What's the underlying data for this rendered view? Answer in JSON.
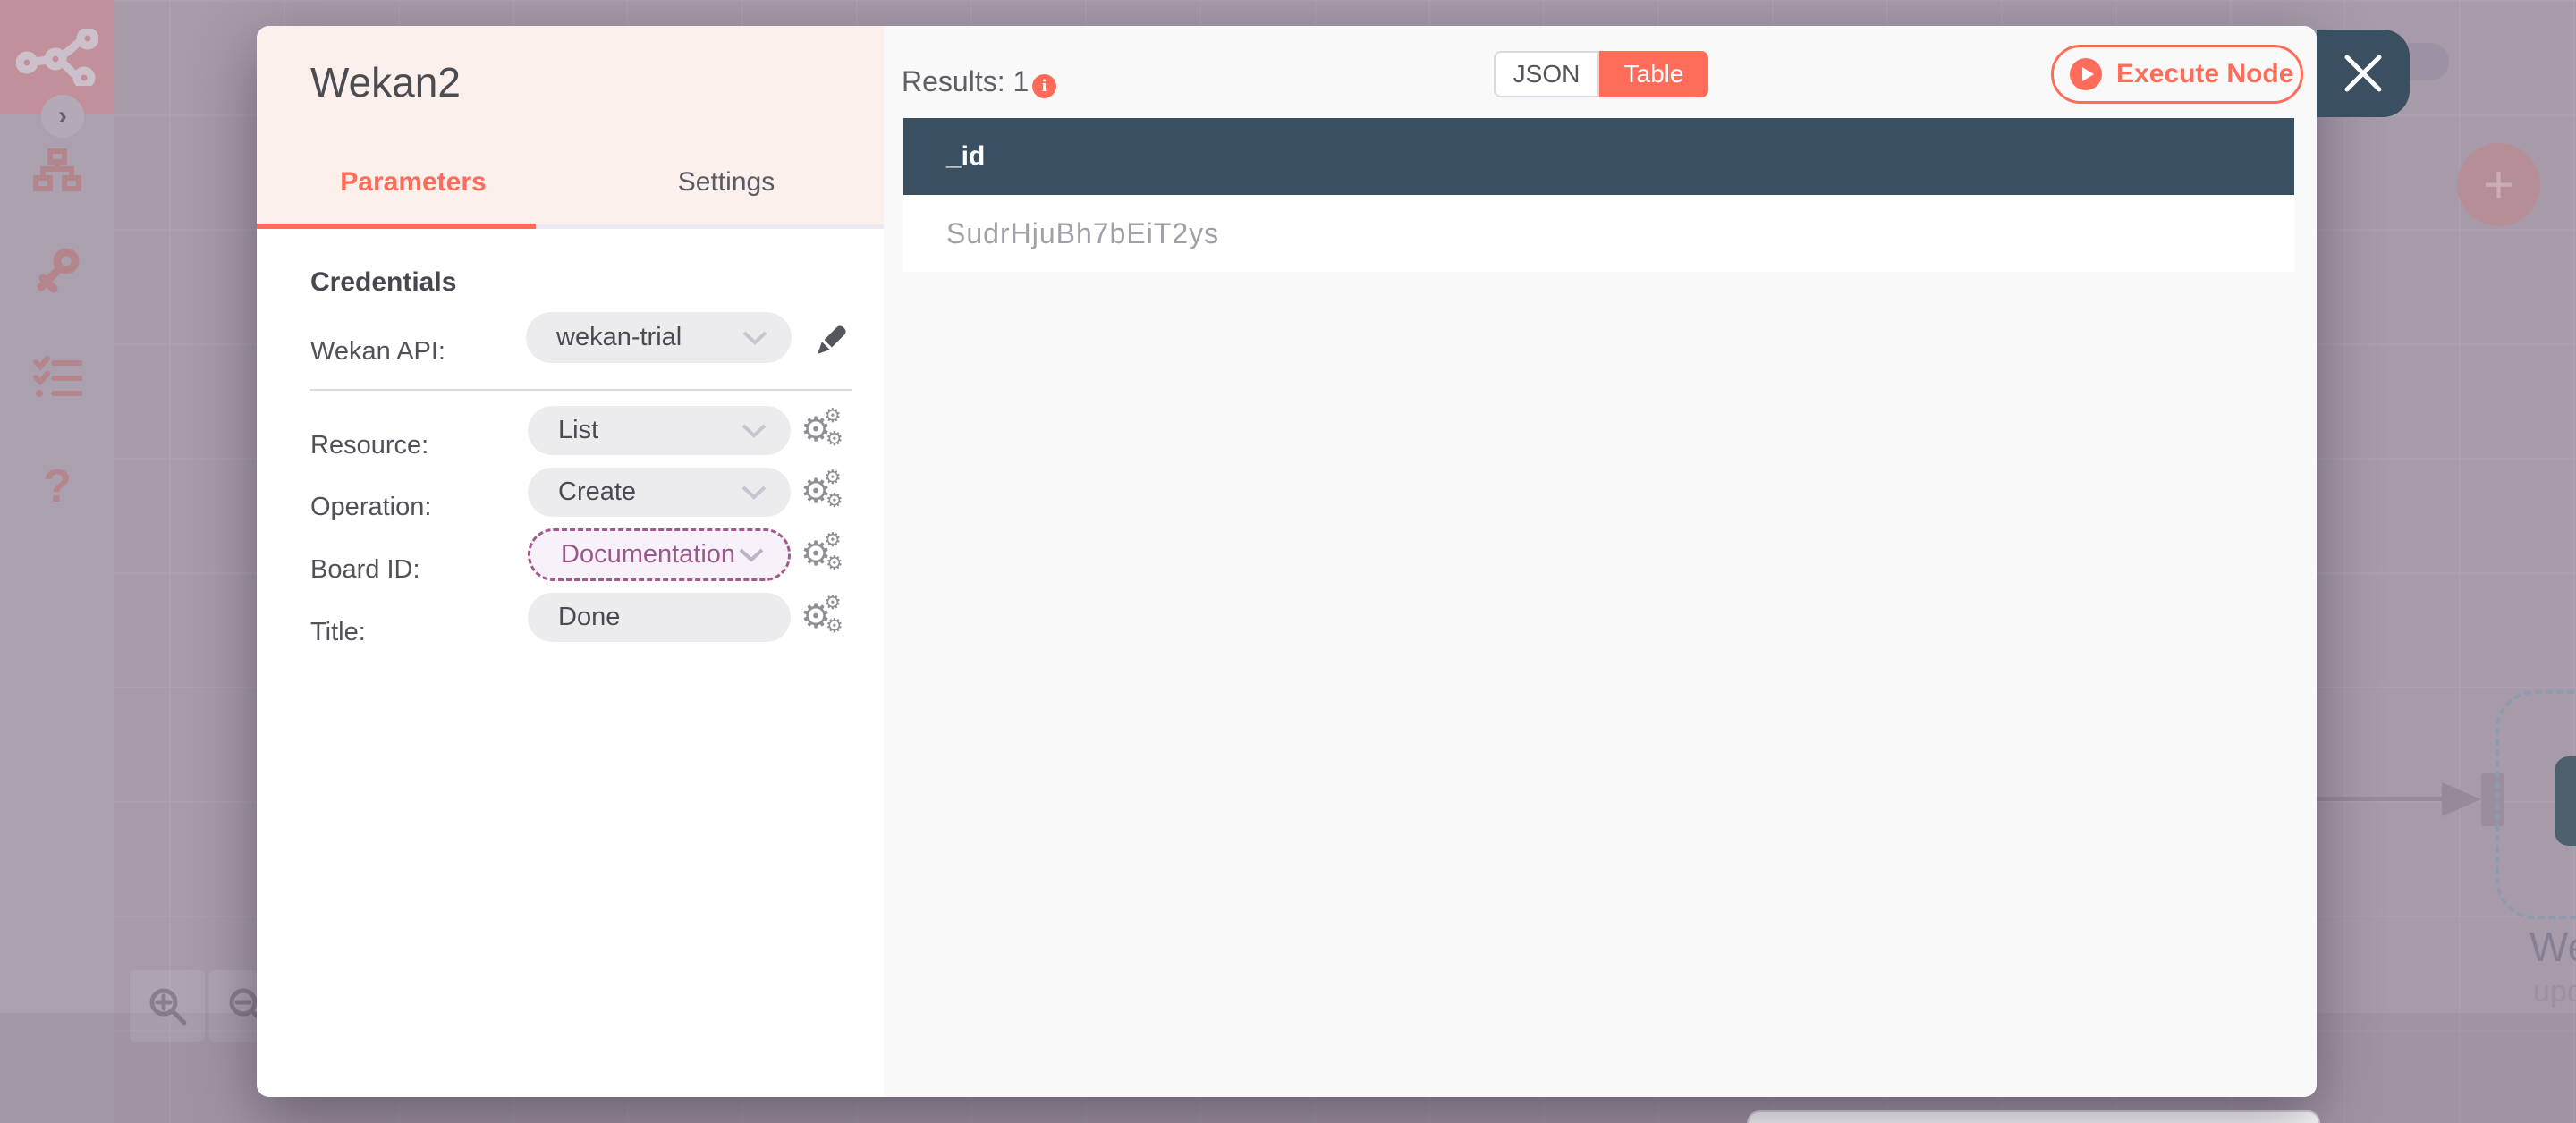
{
  "modal": {
    "title": "Wekan2",
    "tabs": {
      "parameters": "Parameters",
      "settings": "Settings"
    },
    "credentials": {
      "heading": "Credentials",
      "label": "Wekan API:",
      "value": "wekan-trial"
    },
    "parameters": [
      {
        "label": "Resource:",
        "value": "List"
      },
      {
        "label": "Operation:",
        "value": "Create"
      },
      {
        "label": "Board ID:",
        "value": "Documentation"
      },
      {
        "label": "Title:",
        "value": "Done"
      }
    ],
    "results": {
      "label": "Results: 1",
      "info_glyph": "i",
      "toggle": {
        "json": "JSON",
        "table": "Table",
        "active": "Table"
      },
      "execute_label": "Execute Node",
      "table": {
        "column": "_id",
        "cell": "SudrHjuBh7bEiT2ys"
      }
    }
  },
  "canvas": {
    "node_label_clipped": "We",
    "node_sublabel_clipped": "upd",
    "help_glyph": "?",
    "add_glyph": "+",
    "expand_glyph": "›"
  },
  "colors": {
    "accent": "#ff6d5a",
    "table_header": "#3a4f60",
    "expression_text": "#9d568c",
    "close_button_bg": "#3a4f5f",
    "modal_header_bg": "#fbf0ec"
  }
}
